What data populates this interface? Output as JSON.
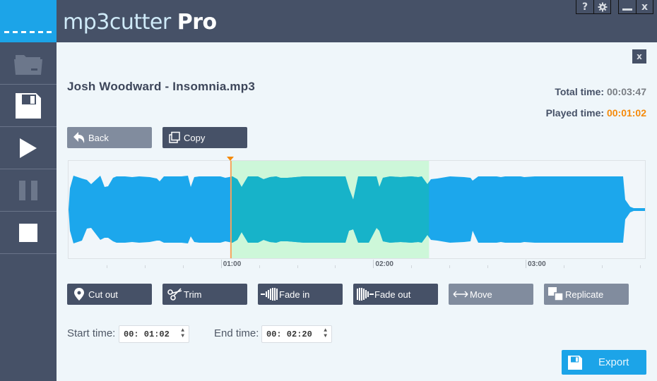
{
  "app": {
    "title_part1": "mp3",
    "title_part2": "cutter",
    "title_part3": "Pro"
  },
  "window_controls": {
    "help": "?",
    "settings": "gear-icon",
    "minimize": "_",
    "close": "x"
  },
  "sidebar": {
    "items": [
      {
        "name": "open",
        "icon": "folder-icon",
        "enabled": false
      },
      {
        "name": "save",
        "icon": "save-icon",
        "enabled": true
      },
      {
        "name": "play",
        "icon": "play-icon",
        "enabled": true
      },
      {
        "name": "pause",
        "icon": "pause-icon",
        "enabled": false
      },
      {
        "name": "stop",
        "icon": "stop-icon",
        "enabled": true
      }
    ]
  },
  "main": {
    "close_label": "x",
    "file_title": "Josh Woodward - Insomnia.mp3",
    "total_time_label": "Total time:",
    "total_time_value": "00:03:47",
    "played_time_label": "Played time:",
    "played_time_value": "00:01:02",
    "back_label": "Back",
    "copy_label": "Copy"
  },
  "waveform": {
    "duration_seconds": 227,
    "playhead_seconds": 62,
    "selection_start_seconds": 62,
    "selection_end_seconds": 140,
    "axis_labels": [
      "01:00",
      "02:00",
      "03:00"
    ],
    "colors": {
      "wave": "#1ca7ec",
      "wave_selected": "#17b3c9",
      "selection_bg": "#cdf7d9",
      "playhead": "#f7a35c"
    }
  },
  "actions": [
    {
      "label": "Cut out",
      "icon": "location-pin-icon",
      "style": "dark"
    },
    {
      "label": "Trim",
      "icon": "scissors-icon",
      "style": "dark"
    },
    {
      "label": "Fade in",
      "icon": "fade-in-icon",
      "style": "dark"
    },
    {
      "label": "Fade out",
      "icon": "fade-out-icon",
      "style": "dark"
    },
    {
      "label": "Move",
      "icon": "move-arrows-icon",
      "style": "light"
    },
    {
      "label": "Replicate",
      "icon": "replicate-icon",
      "style": "light"
    }
  ],
  "times": {
    "start_label": "Start time:",
    "start_value": "00: 01:02",
    "end_label": "End time:",
    "end_value": "00: 02:20"
  },
  "export_label": "Export"
}
